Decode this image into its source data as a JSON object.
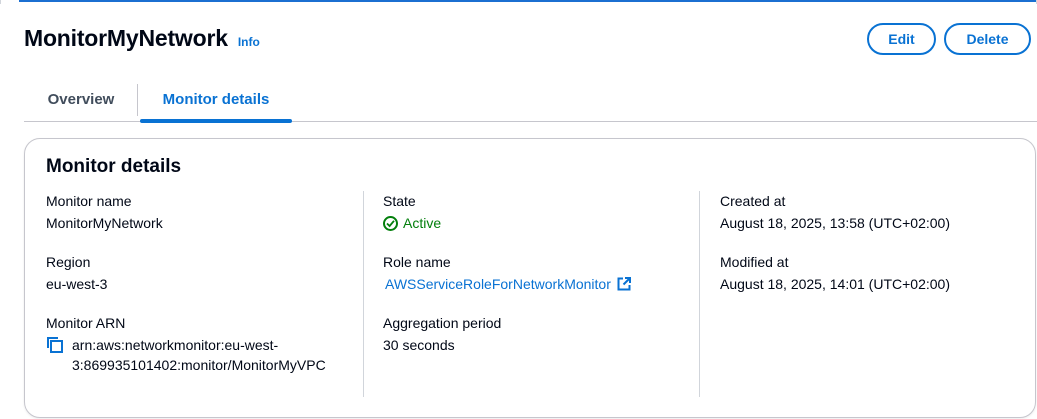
{
  "header": {
    "title": "MonitorMyNetwork",
    "info_label": "Info",
    "edit_label": "Edit",
    "delete_label": "Delete"
  },
  "tabs": [
    {
      "label": "Overview",
      "active": false
    },
    {
      "label": "Monitor details",
      "active": true
    }
  ],
  "details": {
    "title": "Monitor details",
    "monitor_name_label": "Monitor name",
    "monitor_name": "MonitorMyNetwork",
    "region_label": "Region",
    "region": "eu-west-3",
    "arn_label": "Monitor ARN",
    "arn": "arn:aws:networkmonitor:eu-west-3:869935101402:monitor/MonitorMyVPC",
    "state_label": "State",
    "state": "Active",
    "role_label": "Role name",
    "role": "AWSServiceRoleForNetworkMonitor",
    "aggregation_label": "Aggregation period",
    "aggregation": "30 seconds",
    "created_label": "Created at",
    "created": "August 18, 2025, 13:58 (UTC+02:00)",
    "modified_label": "Modified at",
    "modified": "August 18, 2025, 14:01 (UTC+02:00)"
  },
  "colors": {
    "accent": "#0972d3",
    "success": "#037f0c",
    "text": "#000716",
    "border": "#c6c6cd"
  },
  "icons": {
    "copy": "copy-icon",
    "status": "status-positive-icon",
    "external": "external-link-icon"
  }
}
